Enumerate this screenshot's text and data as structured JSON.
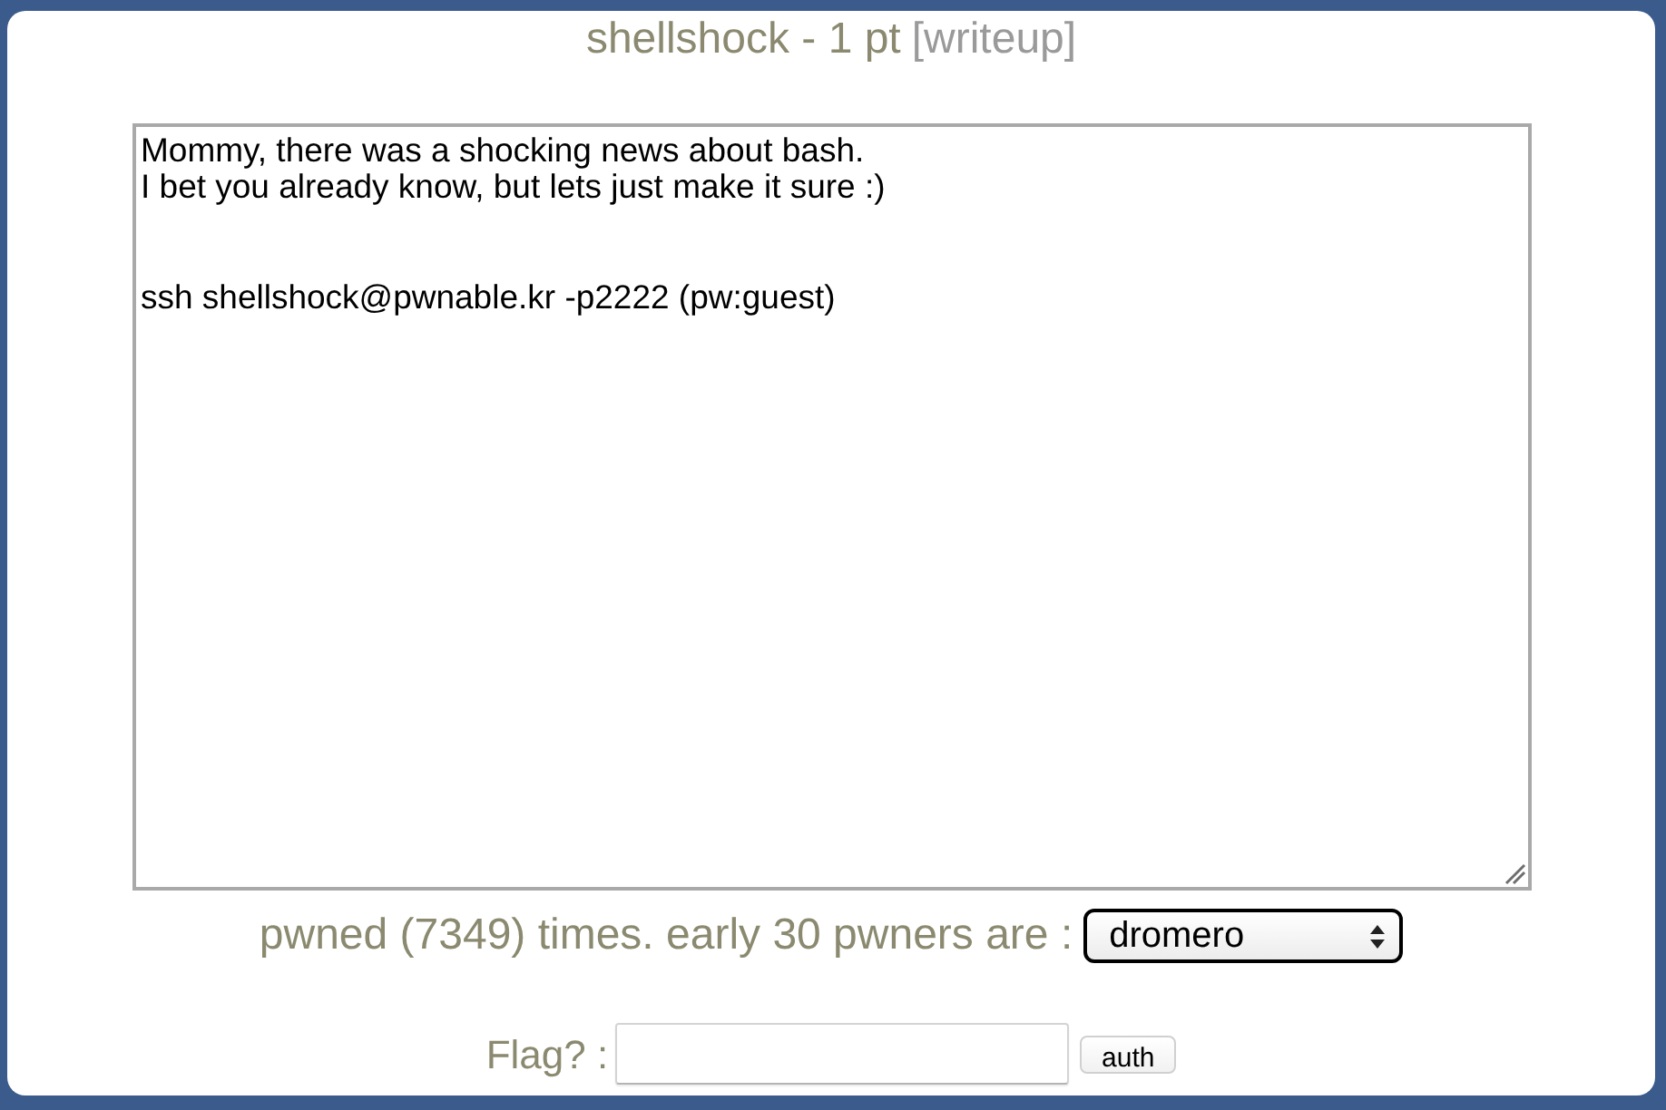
{
  "title": {
    "name": "shellshock - 1 pt",
    "link": "[writeup]"
  },
  "description": {
    "text": "Mommy, there was a shocking news about bash.\nI bet you already know, but lets just make it sure :)\n\n\nssh shellshock@pwnable.kr -p2222 (pw:guest)"
  },
  "pwners": {
    "label": "pwned (7349) times. early 30 pwners are :",
    "selected_value": "dromero"
  },
  "flag": {
    "label": "Flag? :",
    "button": "auth"
  }
}
